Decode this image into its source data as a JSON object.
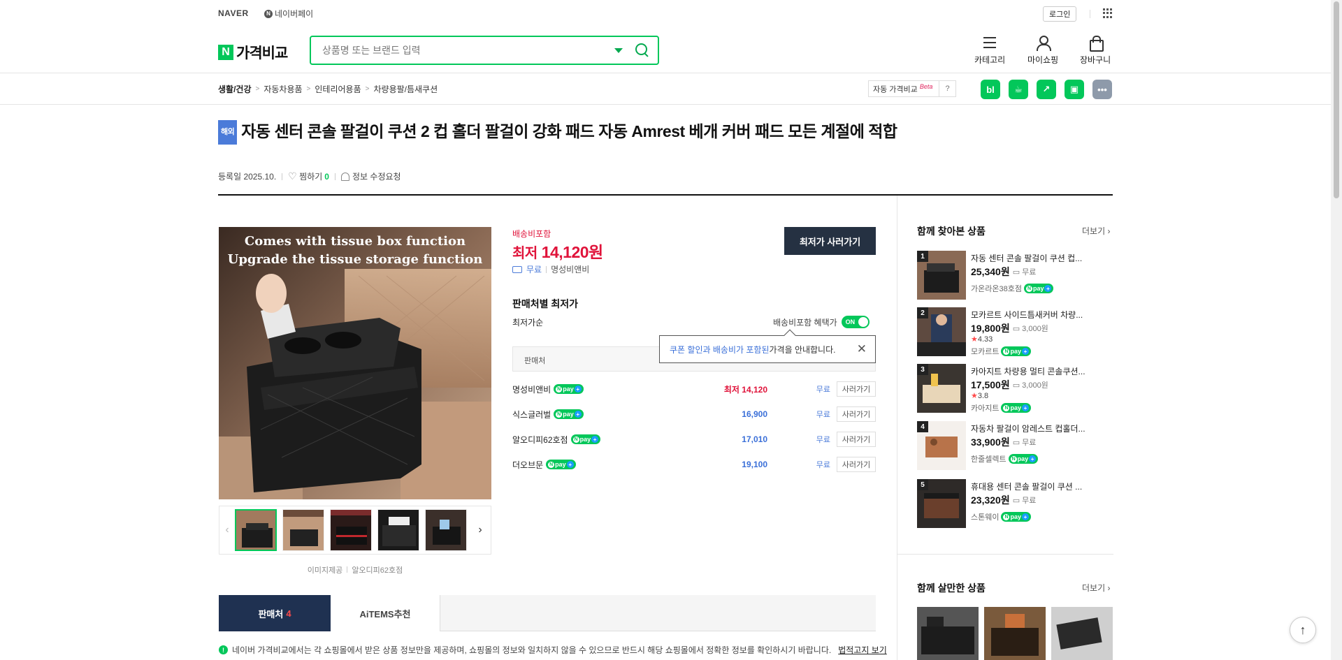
{
  "topbar": {
    "naver": "NAVER",
    "npay": "네이버페이",
    "login": "로그인"
  },
  "header": {
    "brand": "가격비교",
    "brand_mark": "N",
    "search_placeholder": "상품명 또는 브랜드 입력",
    "nav": [
      {
        "label": "카테고리"
      },
      {
        "label": "마이쇼핑"
      },
      {
        "label": "장바구니"
      }
    ]
  },
  "breadcrumb": [
    "생활/건강",
    "자동차용품",
    "인테리어용품",
    "차량용팔/틈새쿠션"
  ],
  "autocomplete": {
    "label": "자동 가격비교",
    "beta": "Beta",
    "help": "?"
  },
  "share": [
    {
      "label": "bl",
      "color": "#03c75a"
    },
    {
      "label": "☕",
      "color": "#03c75a"
    },
    {
      "label": "↗",
      "color": "#03c75a"
    },
    {
      "label": "▣",
      "color": "#03c75a"
    },
    {
      "label": "•••",
      "color": "#8e9aaa"
    }
  ],
  "product": {
    "badge": "해외",
    "title": "자동 센터 콘솔 팔걸이 쿠션 2 컵 홀더 팔걸이 강화 패드 자동 Amrest 베개 커버 패드 모든 계절에 적합",
    "registered": "등록일 2025.10.",
    "wish_label": "찜하기",
    "wish_count": "0",
    "report": "정보 수정요청",
    "image_text_1": "Comes with tissue box function",
    "image_text_2": "Upgrade the tissue storage function",
    "image_credit_left": "이미지제공",
    "image_credit_right": "알오디피62호점"
  },
  "price": {
    "shipping_included": "배송비포함",
    "lowest_prefix": "최저",
    "lowest_value": "14,120원",
    "ship_free": "무료",
    "seller": "명성비앤비",
    "buy_lowest": "최저가 사러가기"
  },
  "sellers": {
    "title": "판매처별 최저가",
    "sort": "최저가순",
    "toggle_label": "배송비포함 혜택가",
    "toggle_state": "ON",
    "table_head": "판매처",
    "tooltip_blue": "쿠폰 할인과 배송비가 포함된",
    "tooltip_rest": " 가격을 안내합니다.",
    "npay_text": "pay",
    "rows": [
      {
        "mall": "명성비앤비",
        "price": "14,120",
        "price_prefix": "최저",
        "ship": "무료",
        "buy": "사러가기"
      },
      {
        "mall": "식스글러벌",
        "price": "16,900",
        "price_prefix": "",
        "ship": "무료",
        "buy": "사러가기"
      },
      {
        "mall": "알오디피62호점",
        "price": "17,010",
        "price_prefix": "",
        "ship": "무료",
        "buy": "사러가기"
      },
      {
        "mall": "더오브문",
        "price": "19,100",
        "price_prefix": "",
        "ship": "무료",
        "buy": "사러가기"
      }
    ]
  },
  "tabs": [
    {
      "label": "판매처",
      "count": "4"
    },
    {
      "label": "AiTEMS추천",
      "count": ""
    }
  ],
  "notice": {
    "text": "네이버 가격비교에서는 각 쇼핑몰에서 받은 상품 정보만을 제공하며, 쇼핑몰의 정보와 일치하지 않을 수 있으므로 반드시 해당 쇼핑몰에서 정확한 정보를 확인하시기 바랍니다.",
    "link": "법적고지 보기"
  },
  "related": {
    "title": "함께 찾아본 상품",
    "more": "더보기",
    "items": [
      {
        "rank": "1",
        "name": "자동 센터 콘솔 팔걸이 쿠션 컵...",
        "price": "25,340원",
        "ship": "무료",
        "rating": "",
        "store": "가온라온38호점"
      },
      {
        "rank": "2",
        "name": "모카르트 사이드틈새커버 차량...",
        "price": "19,800원",
        "ship": "3,000원",
        "rating": "4.33",
        "store": "모카르트"
      },
      {
        "rank": "3",
        "name": "카아지트 차량용 멀티 콘솔쿠션...",
        "price": "17,500원",
        "ship": "3,000원",
        "rating": "3.8",
        "store": "카아지트"
      },
      {
        "rank": "4",
        "name": "자동차 팔걸이 암레스트 컵홀더...",
        "price": "33,900원",
        "ship": "무료",
        "rating": "",
        "store": "한줄셀렉트"
      },
      {
        "rank": "5",
        "name": "휴대용 센터 콘솔 팔걸이 쿠션 ...",
        "price": "23,320원",
        "ship": "무료",
        "rating": "",
        "store": "스톤웨이"
      }
    ]
  },
  "bought": {
    "title": "함께 살만한 상품",
    "more": "더보기"
  }
}
